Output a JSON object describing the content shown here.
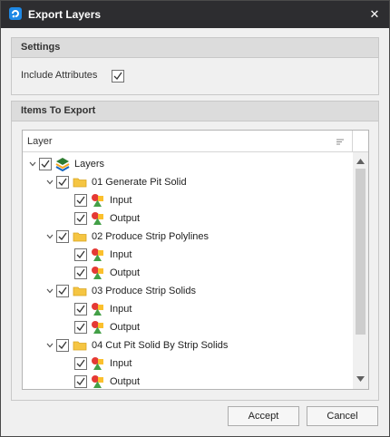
{
  "window": {
    "title": "Export Layers",
    "close_glyph": "✕"
  },
  "settings": {
    "header": "Settings",
    "include_attributes_label": "Include Attributes",
    "include_attributes_checked": true
  },
  "items_to_export": {
    "header": "Items To Export",
    "column_header": "Layer",
    "tree": [
      {
        "label": "Layers",
        "level": 0,
        "icon": "layers-stack-icon",
        "checked": true,
        "expanded": true
      },
      {
        "label": "01 Generate Pit Solid",
        "level": 1,
        "icon": "folder-icon",
        "checked": true,
        "expanded": true
      },
      {
        "label": "Input",
        "level": 2,
        "icon": "shapes-icon",
        "checked": true
      },
      {
        "label": "Output",
        "level": 2,
        "icon": "shapes-icon",
        "checked": true
      },
      {
        "label": "02 Produce Strip Polylines",
        "level": 1,
        "icon": "folder-icon",
        "checked": true,
        "expanded": true
      },
      {
        "label": "Input",
        "level": 2,
        "icon": "shapes-icon",
        "checked": true
      },
      {
        "label": "Output",
        "level": 2,
        "icon": "shapes-icon",
        "checked": true
      },
      {
        "label": "03 Produce Strip Solids",
        "level": 1,
        "icon": "folder-icon",
        "checked": true,
        "expanded": true
      },
      {
        "label": "Input",
        "level": 2,
        "icon": "shapes-icon",
        "checked": true
      },
      {
        "label": "Output",
        "level": 2,
        "icon": "shapes-icon",
        "checked": true
      },
      {
        "label": "04 Cut Pit Solid By Strip Solids",
        "level": 1,
        "icon": "folder-icon",
        "checked": true,
        "expanded": true
      },
      {
        "label": "Input",
        "level": 2,
        "icon": "shapes-icon",
        "checked": true
      },
      {
        "label": "Output",
        "level": 2,
        "icon": "shapes-icon",
        "checked": true
      }
    ]
  },
  "buttons": {
    "accept": "Accept",
    "cancel": "Cancel"
  },
  "colors": {
    "titlebar": "#2d2d30",
    "folder": "#f5c542",
    "group_header": "#dcdcdc"
  }
}
